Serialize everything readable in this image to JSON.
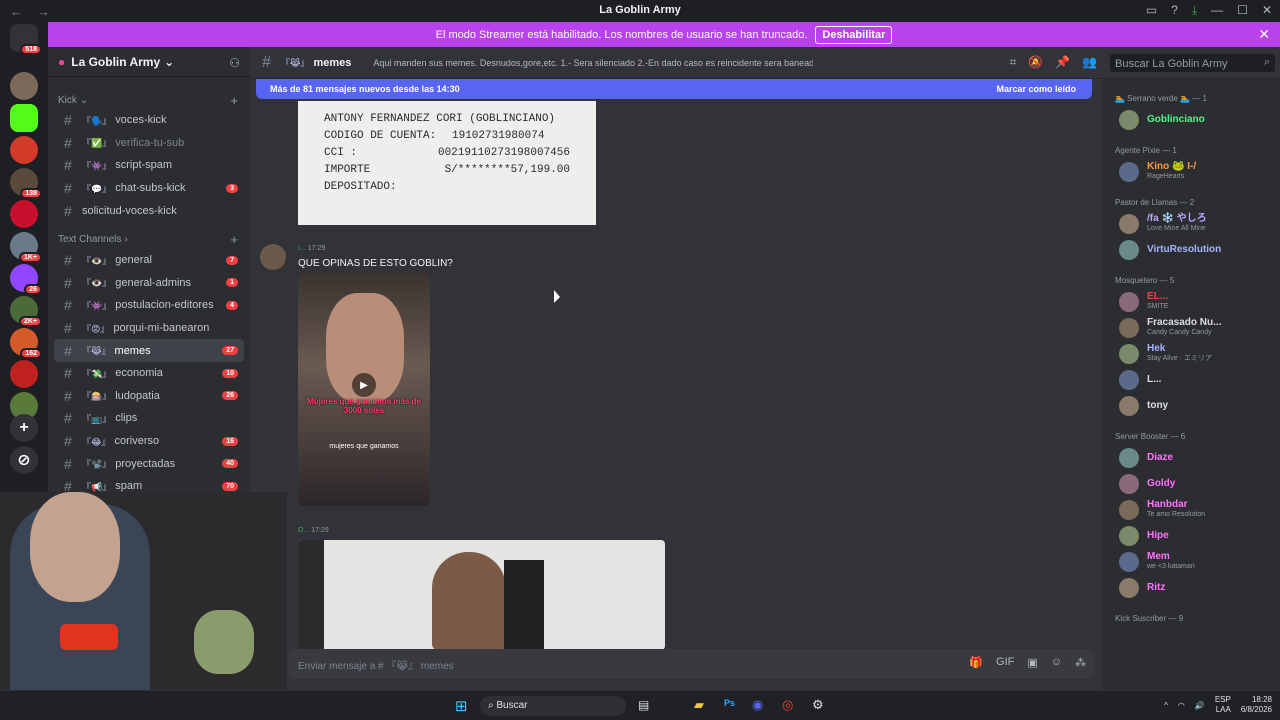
{
  "window": {
    "title": "La Goblin Army"
  },
  "banner": {
    "text": "El modo Streamer está habilitado. Los nombres de usuario se han truncado.",
    "button": "Deshabilitar"
  },
  "server": {
    "name": "La Goblin Army"
  },
  "guilds": [
    {
      "badge": "518",
      "color": "#313338"
    },
    {
      "badge": "",
      "color": "#7b6a5a"
    },
    {
      "badge": "",
      "color": "#53fc18"
    },
    {
      "badge": "",
      "color": "#d23b2a"
    },
    {
      "badge": "138",
      "color": "#5a4a3c"
    },
    {
      "badge": "",
      "color": "#c8102e"
    },
    {
      "badge": "1K+",
      "color": "#6a7a8a"
    },
    {
      "badge": "26",
      "color": "#9146ff"
    },
    {
      "badge": "2K+",
      "color": "#4a6a3a"
    },
    {
      "badge": "162",
      "color": "#d45a2a"
    },
    {
      "badge": "",
      "color": "#c02020"
    },
    {
      "badge": "",
      "color": "#5a7a3a"
    }
  ],
  "categories": {
    "kick": "Kick",
    "text": "Text Channels"
  },
  "kick_channels": [
    {
      "name": "voces-kick",
      "emoji": "『🗣️』",
      "count": "",
      "dim": false
    },
    {
      "name": "verifica-tu-sub",
      "emoji": "『✅』",
      "count": "",
      "dim": true
    },
    {
      "name": "script-spam",
      "emoji": "『👾』",
      "count": "",
      "dim": false
    },
    {
      "name": "chat-subs-kick",
      "emoji": "『💬』",
      "count": "3",
      "dim": false
    },
    {
      "name": "solicitud-voces-kick",
      "emoji": "",
      "count": "",
      "dim": false
    }
  ],
  "text_channels": [
    {
      "name": "general",
      "emoji": "『👁️』",
      "count": "7"
    },
    {
      "name": "general-admins",
      "emoji": "『👁️』",
      "count": "1"
    },
    {
      "name": "postulacion-editores",
      "emoji": "『👾』",
      "count": "4"
    },
    {
      "name": "porqui-mi-banearon",
      "emoji": "『😡』",
      "count": ""
    },
    {
      "name": "memes",
      "emoji": "『😹』",
      "count": "27",
      "active": true
    },
    {
      "name": "economia",
      "emoji": "『💸』",
      "count": "10"
    },
    {
      "name": "ludopatia",
      "emoji": "『🎰』",
      "count": "26"
    },
    {
      "name": "clips",
      "emoji": "『📺』",
      "count": ""
    },
    {
      "name": "coriverso",
      "emoji": "『😂』",
      "count": "16"
    },
    {
      "name": "proyectadas",
      "emoji": "『📽️』",
      "count": "40"
    },
    {
      "name": "spam",
      "emoji": "『📢』",
      "count": "70"
    }
  ],
  "channel_header": {
    "name": "memes",
    "emoji": "『😹』",
    "topic": "Aqui manden sus memes. Desnudos,gore,etc. 1.- Sera silenciado 2.-En dado caso es reincidente sera baneado"
  },
  "search": {
    "placeholder": "Buscar La Goblin Army"
  },
  "new_messages": {
    "text": "Más de 81 mensajes nuevos desde las 14:30",
    "mark": "Marcar como leído"
  },
  "receipt": {
    "line1": "ANTONY FERNANDEZ CORI (GOBLINCIANO)",
    "rows": [
      {
        "k": "CODIGO DE CUENTA:",
        "v": "19102731980074"
      },
      {
        "k": "CCI           :",
        "v": "00219110273198007456"
      },
      {
        "k": "IMPORTE DEPOSITADO:",
        "v": "S/********57,199.00"
      }
    ]
  },
  "messages": [
    {
      "author": "I...",
      "time": "17:29",
      "text": "QUE OPINAS DE ESTO GOBLIN?",
      "caption1": "Mujeres que ganamos más de 3000 soles",
      "caption2": "mujeres que ganamos"
    },
    {
      "author": "O...",
      "time": "17:29"
    }
  ],
  "composer": {
    "placeholder": "Enviar mensaje a # 『😹』 memes"
  },
  "member_groups": [
    {
      "title": "🏊 Serrano verde 🏊 — 1",
      "members": [
        {
          "name": "Goblinciano",
          "status": "",
          "color": "#57f287"
        }
      ]
    },
    {
      "title": "Agente Pixie — 1",
      "members": [
        {
          "name": "Kino 🐸 I-/",
          "status": "RageHearts",
          "color": "#ff9a3c"
        }
      ]
    },
    {
      "title": "Pastor de Llamas — 2",
      "members": [
        {
          "name": "/fa ❄️ やしろ",
          "status": "Love Mine All Mine",
          "color": "#b9a9ff"
        },
        {
          "name": "VirtuResolution",
          "status": "",
          "color": "#a6b4ff"
        }
      ]
    },
    {
      "title": "Mosquetero — 5",
      "members": [
        {
          "name": "EL...",
          "status": "SMITE",
          "color": "#ed4245"
        },
        {
          "name": "Fracasado Nu...",
          "status": "Candy Candy Candy",
          "color": "#dbdee1"
        },
        {
          "name": "Hek",
          "status": "Stay Alive · エミリア",
          "color": "#a6b4ff"
        },
        {
          "name": "L...",
          "status": "",
          "color": "#dbdee1"
        },
        {
          "name": "tony",
          "status": "",
          "color": "#dbdee1"
        }
      ]
    },
    {
      "title": "Server Booster — 6",
      "members": [
        {
          "name": "Diaze",
          "status": "",
          "color": "#ff73fa"
        },
        {
          "name": "Goldy",
          "status": "",
          "color": "#ff73fa"
        },
        {
          "name": "Hanbdar",
          "status": "Te amo Resolution",
          "color": "#ff73fa"
        },
        {
          "name": "Hipe",
          "status": "",
          "color": "#ff73fa"
        },
        {
          "name": "Mem",
          "status": "we <3 katamari",
          "color": "#ff73fa"
        },
        {
          "name": "Ritz",
          "status": "",
          "color": "#ff73fa"
        }
      ]
    },
    {
      "title": "Kick Suscriber — 9",
      "members": []
    }
  ],
  "taskbar": {
    "search": "Buscar",
    "lang1": "ESP",
    "lang2": "LAA",
    "time": "18:28",
    "date": "6/8/2026"
  }
}
